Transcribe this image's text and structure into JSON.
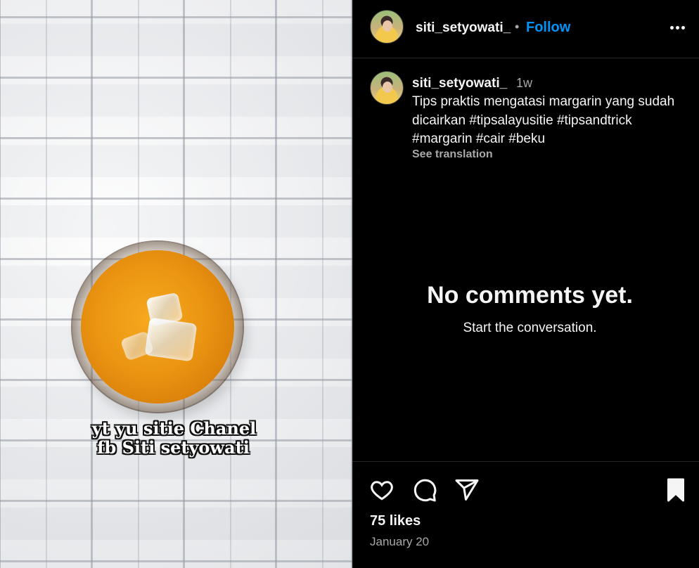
{
  "post": {
    "media": {
      "overlay_line1": "yt yu sitie Chanel",
      "overlay_line2": "fb Siti setyowati",
      "description": "glass of orange juice with ice on white brick wall"
    },
    "header": {
      "username": "siti_setyowati_",
      "separator": "•",
      "follow_label": "Follow",
      "more_icon": "more-horizontal-icon"
    },
    "caption": {
      "username": "siti_setyowati_",
      "time": "1w",
      "text": "Tips praktis mengatasi margarin yang sudah dicairkan #tipsalayusitie #tipsandtrick #margarin #cair #beku",
      "see_translation": "See translation"
    },
    "comments": {
      "empty_title": "No comments yet.",
      "empty_subtitle": "Start the conversation."
    },
    "actions": {
      "like_icon": "heart-icon",
      "comment_icon": "comment-icon",
      "share_icon": "send-icon",
      "save_icon": "bookmark-icon",
      "likes": "75 likes",
      "date": "January 20"
    },
    "colors": {
      "background": "#000000",
      "accent": "#0095f6",
      "text": "#f5f5f5",
      "muted": "#a8a8a8",
      "divider": "#262626"
    }
  }
}
